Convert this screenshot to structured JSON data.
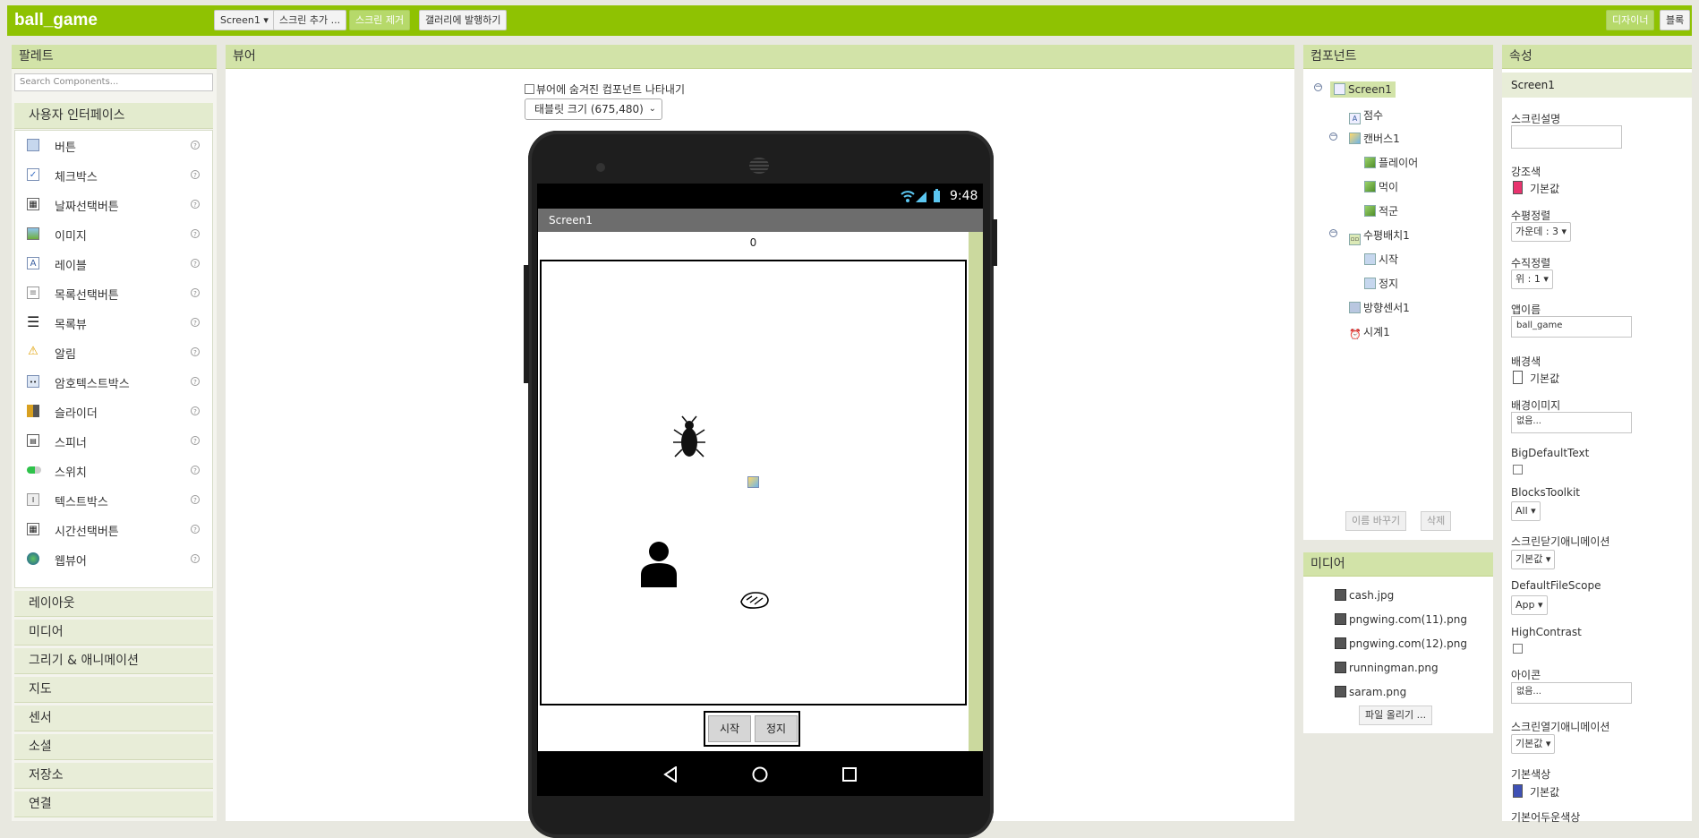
{
  "app": {
    "name": "ball_game"
  },
  "toolbar": {
    "screen_select": "Screen1 ▾",
    "add_screen": "스크린 추가 ...",
    "remove_screen": "스크린 제거",
    "publish_gallery": "갤러리에 발행하기",
    "designer": "디자이너",
    "blocks": "블록"
  },
  "palette": {
    "title": "팔레트",
    "search_placeholder": "Search Components...",
    "open_category": "사용자 인터페이스",
    "items": [
      {
        "label": "버튼",
        "icon": "button-icon"
      },
      {
        "label": "체크박스",
        "icon": "checkbox-icon"
      },
      {
        "label": "날짜선택버튼",
        "icon": "datepicker-icon"
      },
      {
        "label": "이미지",
        "icon": "image-icon"
      },
      {
        "label": "레이블",
        "icon": "label-icon"
      },
      {
        "label": "목록선택버튼",
        "icon": "listpicker-icon"
      },
      {
        "label": "목록뷰",
        "icon": "listview-icon"
      },
      {
        "label": "알림",
        "icon": "notifier-icon"
      },
      {
        "label": "암호텍스트박스",
        "icon": "passwordbox-icon"
      },
      {
        "label": "슬라이더",
        "icon": "slider-icon"
      },
      {
        "label": "스피너",
        "icon": "spinner-icon"
      },
      {
        "label": "스위치",
        "icon": "switch-icon"
      },
      {
        "label": "텍스트박스",
        "icon": "textbox-icon"
      },
      {
        "label": "시간선택버튼",
        "icon": "timepicker-icon"
      },
      {
        "label": "웹뷰어",
        "icon": "webviewer-icon"
      }
    ],
    "categories": [
      "레이아웃",
      "미디어",
      "그리기 & 애니메이션",
      "지도",
      "센서",
      "소셜",
      "저장소",
      "연결"
    ]
  },
  "viewer": {
    "title": "뷰어",
    "show_hidden": "뷰어에 숨겨진 컴포넌트 나타내기",
    "size": "태블릿 크기 (675,480)",
    "status_time": "9:48",
    "screen_title": "Screen1",
    "score": "0",
    "start_button": "시작",
    "stop_button": "정지"
  },
  "components": {
    "title": "컴포넌트",
    "tree": [
      "Screen1",
      "점수",
      "캔버스1",
      "플레이어",
      "먹이",
      "적군",
      "수평배치1",
      "시작",
      "정지",
      "방향센서1",
      "시계1"
    ],
    "rename": "이름 바꾸기",
    "delete": "삭제"
  },
  "media": {
    "title": "미디어",
    "files": [
      "cash.jpg",
      "pngwing.com(11).png",
      "pngwing.com(12).png",
      "runningman.png",
      "saram.png"
    ],
    "upload": "파일 올리기 ..."
  },
  "properties": {
    "title": "속성",
    "component": "Screen1",
    "screen_desc_label": "스크린설명",
    "accent_label": "강조색",
    "accent_value": "기본값",
    "accent_color": "#e8336e",
    "halign_label": "수평정렬",
    "halign_value": "가운데 : 3 ▾",
    "valign_label": "수직정렬",
    "valign_value": "위 : 1 ▾",
    "appname_label": "앱이름",
    "appname_value": "ball_game",
    "bgcolor_label": "배경색",
    "bgcolor_value": "기본값",
    "bgimage_label": "배경이미지",
    "bgimage_value": "없음...",
    "bigtext_label": "BigDefaultText",
    "toolkit_label": "BlocksToolkit",
    "toolkit_value": "All ▾",
    "close_anim_label": "스크린닫기애니메이션",
    "close_anim_value": "기본값 ▾",
    "filescope_label": "DefaultFileScope",
    "filescope_value": "App ▾",
    "contrast_label": "HighContrast",
    "icon_label": "아이콘",
    "icon_value": "없음...",
    "open_anim_label": "스크린열기애니메이션",
    "open_anim_value": "기본값 ▾",
    "primary_label": "기본색상",
    "primary_value": "기본값",
    "primary_color": "#3f51b5",
    "primary_dark_label": "기본어두운색상"
  }
}
